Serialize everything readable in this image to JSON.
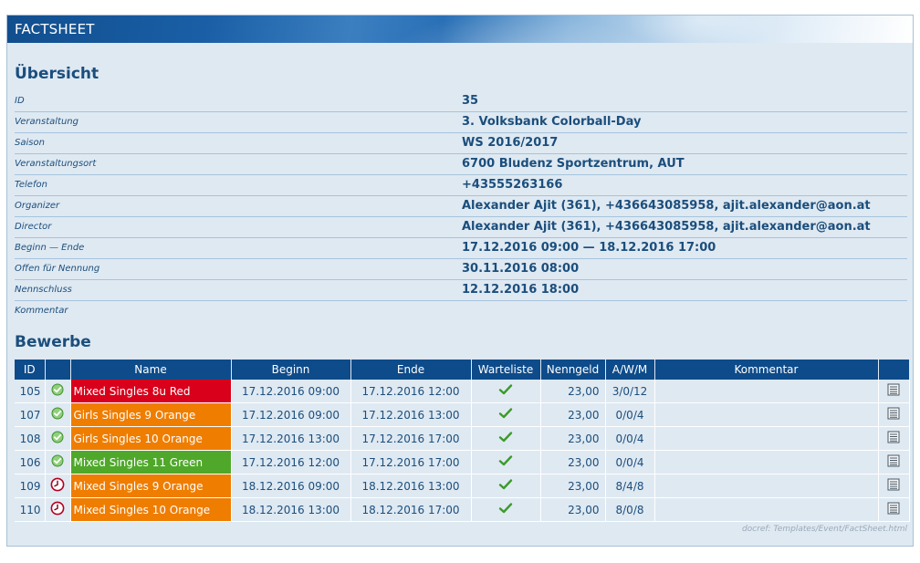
{
  "banner": {
    "title": "FACTSHEET"
  },
  "overview": {
    "heading": "Übersicht",
    "rows": [
      {
        "label": "ID",
        "value": "35"
      },
      {
        "label": "Veranstaltung",
        "value": "3. Volksbank Colorball-Day"
      },
      {
        "label": "Saison",
        "value": "WS 2016/2017"
      },
      {
        "label": "Veranstaltungsort",
        "value": "6700 Bludenz Sportzentrum, AUT"
      },
      {
        "label": "Telefon",
        "value": "+43555263166"
      },
      {
        "label": "Organizer",
        "value": "Alexander Ajit (361), +436643085958, ajit.alexander@aon.at"
      },
      {
        "label": "Director",
        "value": "Alexander Ajit (361), +436643085958, ajit.alexander@aon.at"
      },
      {
        "label": "Beginn — Ende",
        "value": "17.12.2016 09:00 — 18.12.2016 17:00"
      },
      {
        "label": "Offen für Nennung",
        "value": "30.11.2016 08:00"
      },
      {
        "label": "Nennschluss",
        "value": "12.12.2016 18:00"
      },
      {
        "label": "Kommentar",
        "value": ""
      }
    ]
  },
  "competitions": {
    "heading": "Bewerbe",
    "columns": [
      "ID",
      "",
      "Name",
      "Beginn",
      "Ende",
      "Warteliste",
      "Nenngeld",
      "A/W/M",
      "Kommentar",
      ""
    ],
    "rows": [
      {
        "id": "105",
        "status": "open-check-icon",
        "name": "Mixed Singles 8u Red",
        "color": "#d9001b",
        "begin": "17.12.2016 09:00",
        "end": "17.12.2016 12:00",
        "waitlist": "checkmark-icon",
        "fee": "23,00",
        "awm": "3/0/12",
        "comment": ""
      },
      {
        "id": "107",
        "status": "open-check-icon",
        "name": "Girls Singles 9 Orange",
        "color": "#ef7d00",
        "begin": "17.12.2016 09:00",
        "end": "17.12.2016 13:00",
        "waitlist": "checkmark-icon",
        "fee": "23,00",
        "awm": "0/0/4",
        "comment": ""
      },
      {
        "id": "108",
        "status": "open-check-icon",
        "name": "Girls Singles 10 Orange",
        "color": "#ef7d00",
        "begin": "17.12.2016 13:00",
        "end": "17.12.2016 17:00",
        "waitlist": "checkmark-icon",
        "fee": "23,00",
        "awm": "0/0/4",
        "comment": ""
      },
      {
        "id": "106",
        "status": "open-check-icon",
        "name": "Mixed Singles 11 Green",
        "color": "#4fa82a",
        "begin": "17.12.2016 12:00",
        "end": "17.12.2016 17:00",
        "waitlist": "checkmark-icon",
        "fee": "23,00",
        "awm": "0/0/4",
        "comment": ""
      },
      {
        "id": "109",
        "status": "clock-icon",
        "name": "Mixed Singles 9 Orange",
        "color": "#ef7d00",
        "begin": "18.12.2016 09:00",
        "end": "18.12.2016 13:00",
        "waitlist": "checkmark-icon",
        "fee": "23,00",
        "awm": "8/4/8",
        "comment": ""
      },
      {
        "id": "110",
        "status": "clock-icon",
        "name": "Mixed Singles 10 Orange",
        "color": "#ef7d00",
        "begin": "18.12.2016 13:00",
        "end": "18.12.2016 17:00",
        "waitlist": "checkmark-icon",
        "fee": "23,00",
        "awm": "8/0/8",
        "comment": ""
      }
    ]
  },
  "footer": {
    "docref": "docref: Templates/Event/FactSheet.html"
  }
}
